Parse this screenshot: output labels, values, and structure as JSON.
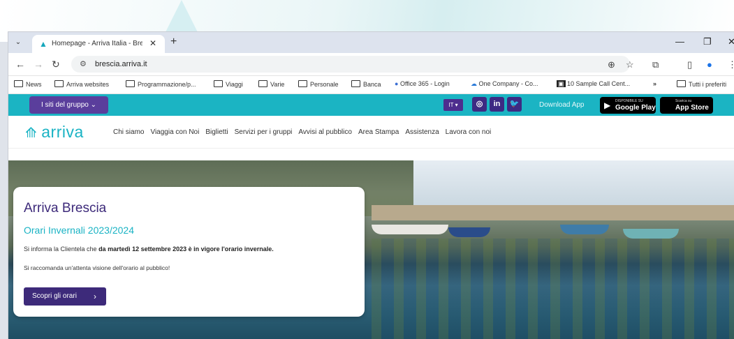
{
  "browser": {
    "tab_title": "Homepage - Arriva Italia - Bres",
    "url": "brescia.arriva.it",
    "bookmarks": [
      "News",
      "Arriva websites",
      "Programmazione/p...",
      "Viaggi",
      "Varie",
      "Personale",
      "Banca",
      "Office 365 - Login",
      "One Company - Co...",
      "10 Sample Call Cent...",
      "»",
      "Tutti i preferiti"
    ]
  },
  "topbar": {
    "group_label": "I siti del gruppo",
    "lang": "IT",
    "social": [
      "instagram",
      "in",
      "twitter"
    ],
    "download_label": "Download App",
    "google_small": "DISPONIBILE SU",
    "google_large": "Google Play",
    "apple_small": "Scarica su",
    "apple_large": "App Store"
  },
  "nav": {
    "logo": "arriva",
    "menu": [
      "Chi siamo",
      "Viaggia con Noi",
      "Biglietti",
      "Servizi per i gruppi",
      "Avvisi al pubblico",
      "Area Stampa",
      "Assistenza",
      "Lavora con noi"
    ]
  },
  "hero": {
    "title": "Arriva Brescia",
    "subtitle": "Orari Invernali 2023/2024",
    "p1_start": "Si informa la Clientela che ",
    "p1_bold": "da martedì 12 settembre 2023 è in vigore l'orario invernale.",
    "p2": "Si raccomanda un'attenta visione dell'orario al pubblico!",
    "button": "Scopri gli orari"
  },
  "colors": {
    "brand_teal": "#1bb4c3",
    "brand_purple": "#3d2a7a"
  }
}
